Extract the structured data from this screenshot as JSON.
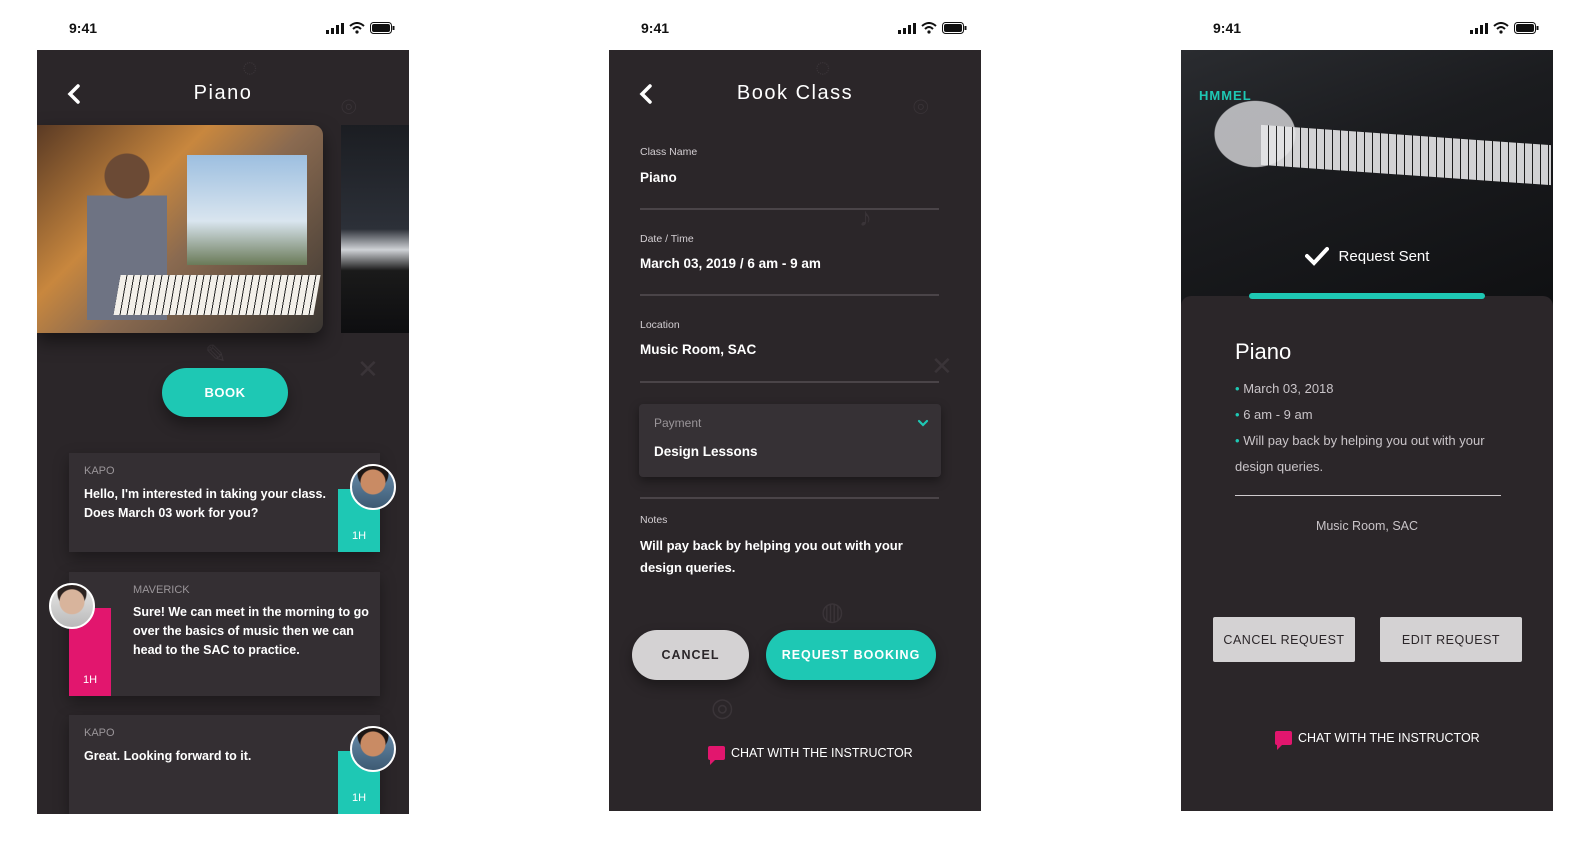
{
  "status": {
    "time": "9:41"
  },
  "screen1": {
    "title": "Piano",
    "book_label": "BOOK",
    "messages": [
      {
        "sender": "KAPO",
        "text_line1": "Hello, I'm interested in taking your class.",
        "text_line2": "Does March 03 work for you?",
        "time": "1H"
      },
      {
        "sender": "MAVERICK",
        "text_line1": "Sure! We can meet in the morning to go",
        "text_line2": "over the basics of music then we can",
        "text_line3": "head to the SAC to practice.",
        "time": "1H"
      },
      {
        "sender": "KAPO",
        "text_line1": "Great. Looking forward to it.",
        "time": "1H"
      }
    ]
  },
  "screen2": {
    "title": "Book Class",
    "class_name_label": "Class Name",
    "class_name_value": "Piano",
    "datetime_label": "Date / Time",
    "datetime_value": "March 03, 2019  / 6 am - 9 am",
    "location_label": "Location",
    "location_value": "Music Room, SAC",
    "payment_label": "Payment",
    "payment_value": "Design Lessons",
    "notes_label": "Notes",
    "notes_value": "Will pay back by helping you out with your design queries.",
    "cancel_label": "CANCEL",
    "request_label": "REQUEST BOOKING",
    "chat_label": "CHAT WITH THE INSTRUCTOR"
  },
  "screen3": {
    "banner_logo": "HMMEL",
    "status_text": "Request Sent",
    "title": "Piano",
    "date": "March 03, 2018",
    "time": "6 am - 9 am",
    "payment_note": "Will pay back by helping you out with your design queries.",
    "location": "Music Room, SAC",
    "cancel_label": "CANCEL REQUEST",
    "edit_label": "EDIT REQUEST",
    "chat_label": "CHAT WITH THE INSTRUCTOR"
  },
  "colors": {
    "accent": "#1ec8b4",
    "pink": "#e2166e",
    "background": "#2b2629",
    "button_grey": "#d4d2d3"
  },
  "icons": [
    "back-arrow-icon",
    "signal-icon",
    "wifi-icon",
    "battery-icon",
    "chevron-down-icon",
    "check-icon",
    "chat-bubble-icon"
  ]
}
